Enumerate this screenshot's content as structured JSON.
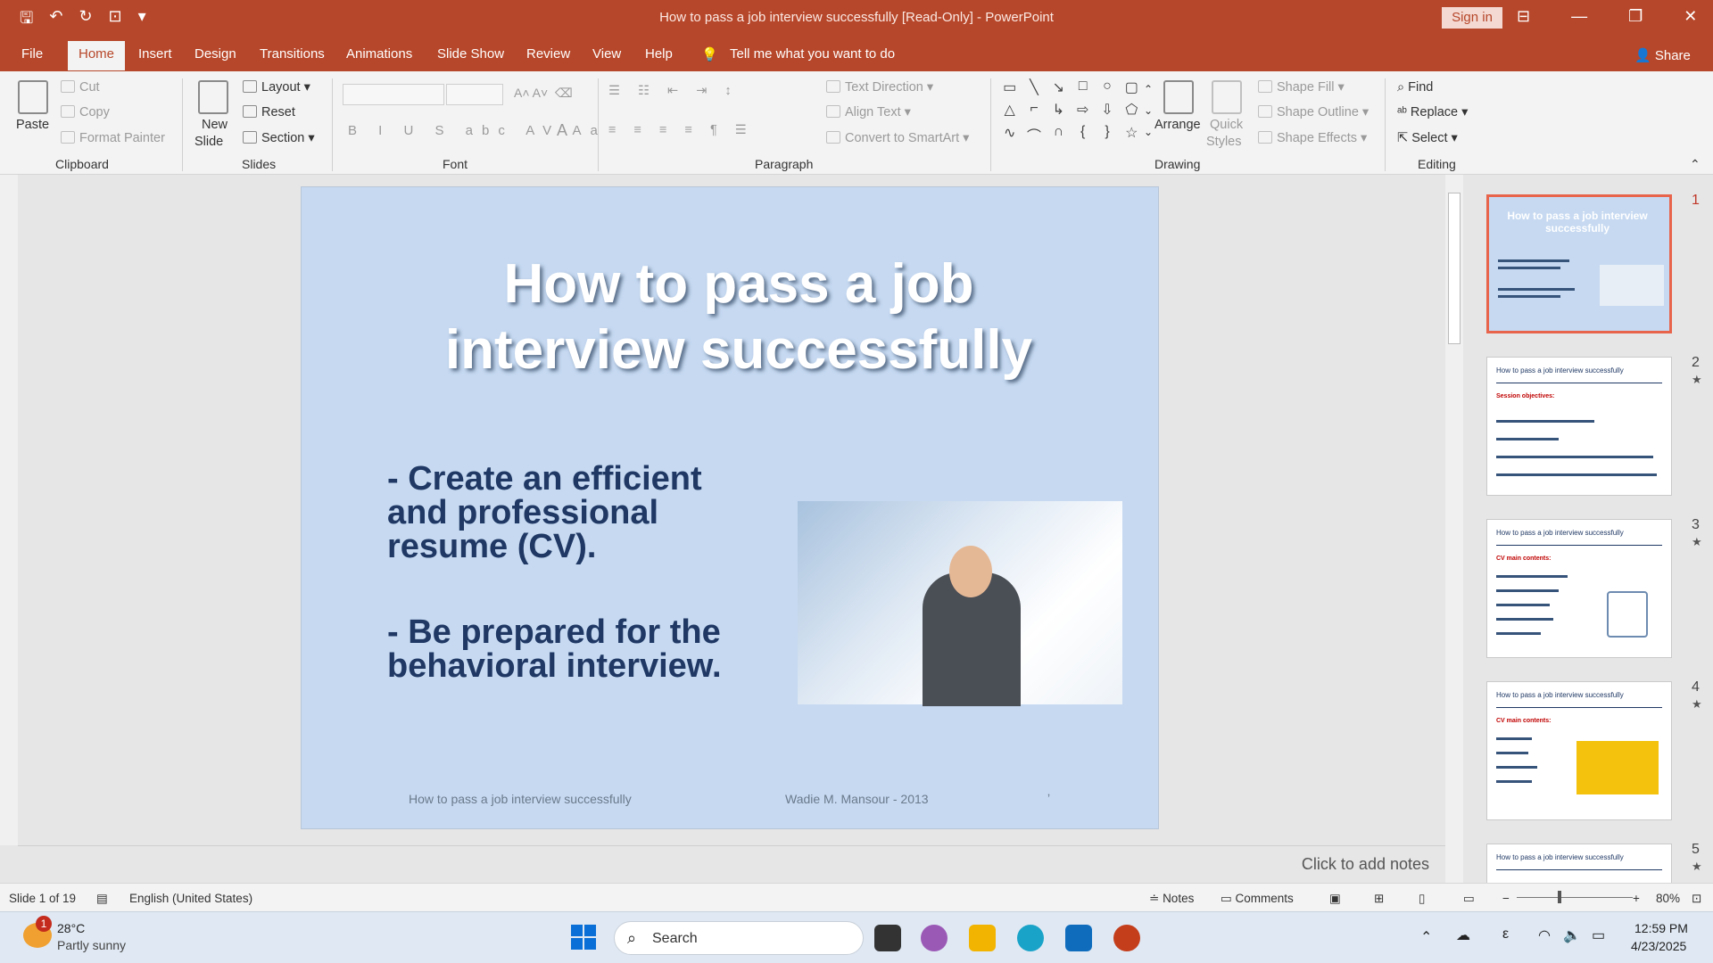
{
  "window": {
    "title": "How to pass a job interview successfully [Read-Only]  -  PowerPoint",
    "sign_in": "Sign in",
    "share": "Share"
  },
  "menu": {
    "tabs": [
      "File",
      "Home",
      "Insert",
      "Design",
      "Transitions",
      "Animations",
      "Slide Show",
      "Review",
      "View",
      "Help"
    ],
    "active": "Home",
    "tell_me": "Tell me what you want to do"
  },
  "ribbon": {
    "clipboard": {
      "paste": "Paste",
      "cut": "Cut",
      "copy": "Copy",
      "format_painter": "Format Painter",
      "label": "Clipboard"
    },
    "slides": {
      "new_slide_1": "New",
      "new_slide_2": "Slide",
      "layout": "Layout",
      "reset": "Reset",
      "section": "Section",
      "label": "Slides"
    },
    "font": {
      "label": "Font"
    },
    "paragraph": {
      "text_direction": "Text Direction",
      "align_text": "Align Text",
      "smartart": "Convert to SmartArt",
      "label": "Paragraph"
    },
    "drawing": {
      "arrange": "Arrange",
      "quick_styles_1": "Quick",
      "quick_styles_2": "Styles",
      "shape_fill": "Shape Fill",
      "shape_outline": "Shape Outline",
      "shape_effects": "Shape Effects",
      "label": "Drawing"
    },
    "editing": {
      "find": "Find",
      "replace": "Replace",
      "select": "Select",
      "label": "Editing"
    }
  },
  "slide": {
    "title_line1": "How to pass a job",
    "title_line2": "interview successfully",
    "bullet1_l1": "- Create an efficient",
    "bullet1_l2": "and professional",
    "bullet1_l3": "resume (CV).",
    "bullet2_l1": "- Be prepared  for the",
    "bullet2_l2": "behavioral interview.",
    "footer_left": "How to pass a job interview successfully",
    "footer_right": "Wadie M. Mansour - 2013",
    "footer_mark": "ʼ"
  },
  "thumbnails": [
    {
      "num": "1",
      "title": "How to pass a job interview successfully",
      "selected": true
    },
    {
      "num": "2",
      "title": "How to pass a job interview successfully",
      "heading": "Session objectives:"
    },
    {
      "num": "3",
      "title": "How to pass a job interview successfully",
      "heading": "CV main contents:"
    },
    {
      "num": "4",
      "title": "How to pass a job interview successfully",
      "heading": "CV main contents:"
    },
    {
      "num": "5",
      "title": "How to pass a job interview successfully"
    }
  ],
  "notes": {
    "placeholder": "Click to add notes"
  },
  "status": {
    "slide": "Slide 1 of 19",
    "language": "English (United States)",
    "notes": "Notes",
    "comments": "Comments",
    "zoom": "80%"
  },
  "taskbar": {
    "temp": "28°C",
    "weather": "Partly sunny",
    "badge": "1",
    "search": "Search",
    "time": "12:59 PM",
    "date": "4/23/2025"
  }
}
